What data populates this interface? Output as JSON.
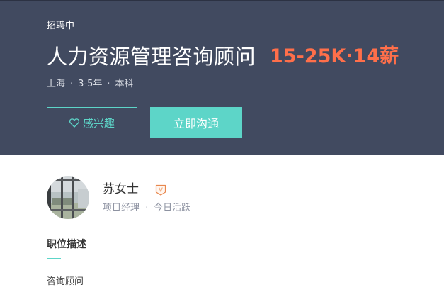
{
  "job": {
    "status": "招聘中",
    "title": "人力资源管理咨询顾问",
    "salary": "15-25K·14薪",
    "location": "上海",
    "experience": "3-5年",
    "education": "本科",
    "separator": "·"
  },
  "actions": {
    "interest_label": "感兴趣",
    "chat_label": "立即沟通"
  },
  "recruiter": {
    "name": "苏女士",
    "badge": "V",
    "position": "项目经理",
    "activity": "今日活跃",
    "separator": "·"
  },
  "section": {
    "title": "职位描述",
    "first_line": "咨询顾问"
  },
  "colors": {
    "header_bg": "#414a60",
    "accent": "#5dd5c8",
    "salary": "#ff6f4a",
    "badge": "#e8874e"
  },
  "icons": {
    "interest": "heart-outline-icon",
    "badge": "vip-badge-icon"
  }
}
